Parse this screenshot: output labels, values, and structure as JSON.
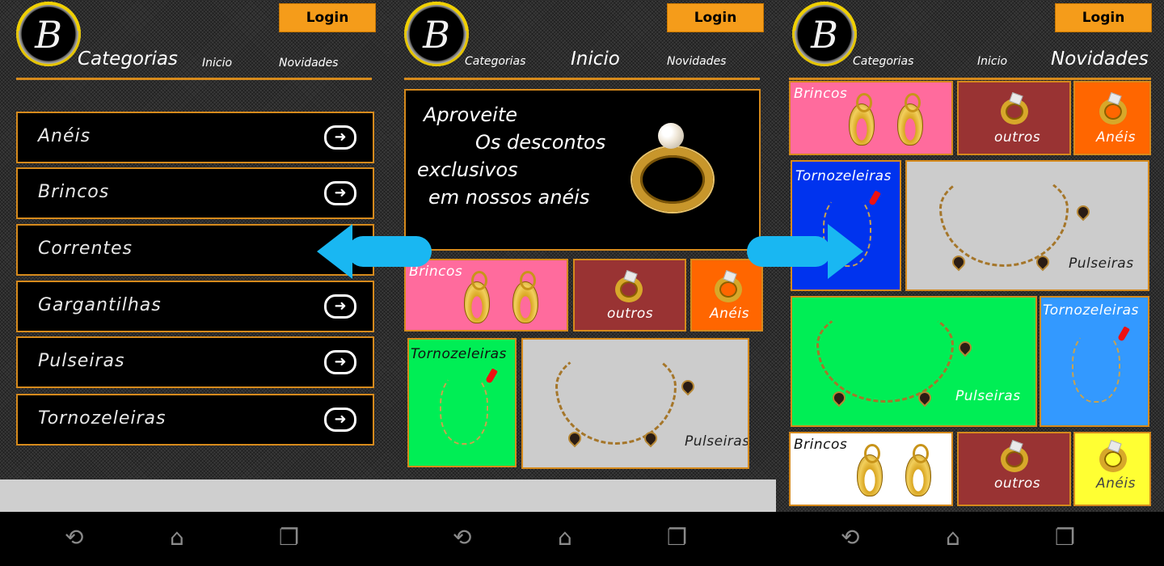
{
  "app": {
    "logo_glyph": "B",
    "login_label": "Login",
    "tabs": {
      "categorias": "Categorias",
      "inicio": "Inicio",
      "novidades": "Novidades"
    },
    "accent_color": "#d68a1c",
    "login_color": "#f59c1a"
  },
  "screen1": {
    "categories": [
      {
        "label": "Anéis"
      },
      {
        "label": "Brincos"
      },
      {
        "label": "Correntes"
      },
      {
        "label": "Gargantilhas"
      },
      {
        "label": "Pulseiras"
      },
      {
        "label": "Tornozeleiras"
      }
    ],
    "row_icon": "arrow-right-circle-icon"
  },
  "screen2": {
    "promo_lines": [
      "Aproveite",
      "Os descontos",
      "exclusivos",
      "em nossos anéis"
    ],
    "tiles": {
      "brincos": "Brincos",
      "outros": "outros",
      "aneis": "Anéis",
      "tornozeleiras": "Tornozeleiras",
      "pulseiras": "Pulseiras"
    }
  },
  "screen3": {
    "tiles": {
      "brincos_top": "Brincos",
      "outros_top": "outros",
      "aneis_top": "Anéis",
      "tornozeleiras_left": "Tornozeleiras",
      "pulseiras_right": "Pulseiras",
      "pulseiras_green": "Pulseiras",
      "tornozeleiras_blue": "Tornozeleiras",
      "brincos_bottom": "Brincos",
      "outros_bottom": "outros",
      "aneis_bottom": "Anéis"
    }
  },
  "navigation_icons": [
    "back-icon",
    "home-icon",
    "recent-apps-icon"
  ],
  "swipe_icons": [
    "swipe-left-arrow-icon",
    "swipe-right-arrow-icon"
  ],
  "colors": {
    "pink": "#ff6b9d",
    "maroon": "#993333",
    "orange": "#ff6600",
    "green": "#00ee55",
    "gray": "#cccccc",
    "blue": "#0033ee",
    "light_blue": "#3399ff",
    "white": "#ffffff",
    "yellow": "#ffff33",
    "swipe_blue": "#19b7f2"
  }
}
